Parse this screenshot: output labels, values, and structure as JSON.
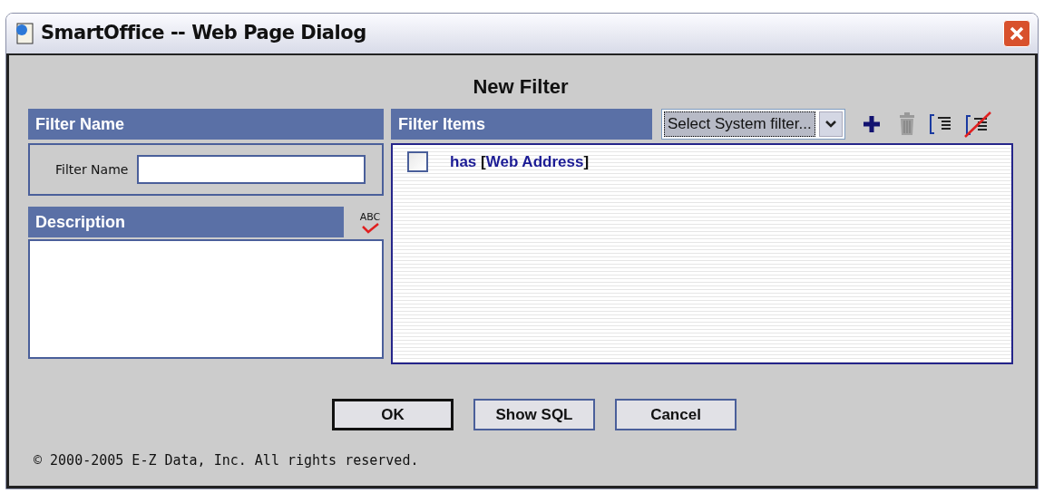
{
  "window": {
    "title": "SmartOffice -- Web Page Dialog"
  },
  "heading": "New Filter",
  "filter_name_section": {
    "header": "Filter Name",
    "label": "Filter Name"
  },
  "description_section": {
    "header": "Description",
    "spell_check_label": "ABC"
  },
  "filter_items_section": {
    "header": "Filter Items",
    "system_filter": {
      "value": "Select System filter..."
    },
    "items": [
      {
        "checked": false,
        "condition": "has",
        "bracket_open": "[",
        "field": "Web Address",
        "bracket_close": "]"
      }
    ]
  },
  "buttons": [
    {
      "label": "OK",
      "default": true
    },
    {
      "label": "Show SQL",
      "default": false
    },
    {
      "label": "Cancel",
      "default": false
    }
  ],
  "footer": "© 2000-2005 E-Z Data, Inc. All rights reserved."
}
